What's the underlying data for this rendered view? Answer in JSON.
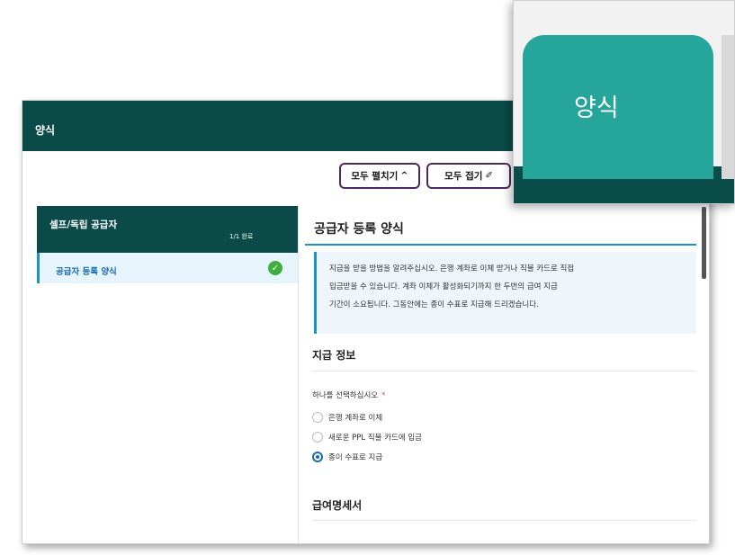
{
  "window": {
    "title": "양식"
  },
  "toolbar": {
    "expand_label": "모두 펼치기",
    "expand_icon": "^",
    "collapse_label": "모두 접기",
    "collapse_icon": "✐"
  },
  "sidebar": {
    "section_title": "셀프/독립 공급자",
    "progress": "1/1 완료",
    "items": [
      {
        "label": "공급자 등록 양식",
        "status_icon": "check-circle-icon",
        "status": "complete"
      }
    ]
  },
  "form": {
    "title": "공급자 등록 양식",
    "info_lines": [
      "지급을 받을 방법을 알려주십시오. 은행 계좌로 이체 받거나 직불 카드로 직접",
      "입금받을 수 있습니다. 계좌 이체가 활성화되기까지 한 두번의 급여 지급",
      "기간이 소요됩니다. 그동안에는 종이 수표로 지급해 드리겠습니다."
    ],
    "payment_section_title": "지급 정보",
    "question": "하나를 선택하십시오",
    "required_mark": "*",
    "options": [
      {
        "label": "은행 계좌로 이체",
        "selected": false
      },
      {
        "label": "새로운 PPL 직불 카드에 입금",
        "selected": false
      },
      {
        "label": "종이 수표로 지급",
        "selected": true
      }
    ],
    "paystub_section_title": "급여명세서"
  },
  "zoom": {
    "tab_label": "양식"
  },
  "colors": {
    "header_bg": "#0a4a48",
    "accent_blue": "#1c8fcd",
    "tab_teal": "#26a69a",
    "check_green": "#3fae3f",
    "button_border": "#4b2a63"
  }
}
